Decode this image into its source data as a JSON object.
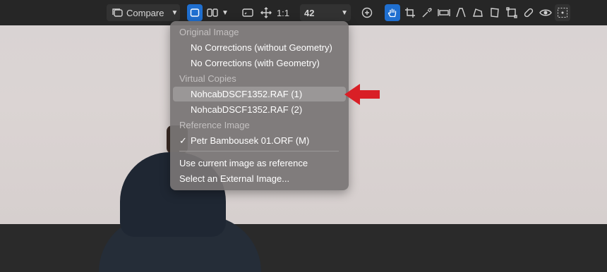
{
  "toolbar": {
    "compare_label": "Compare",
    "zoom_label": "1:1",
    "zoom_value": "42",
    "accent": "#1f6fd0"
  },
  "menu": {
    "sections": {
      "original_header": "Original Image",
      "virtual_header": "Virtual Copies",
      "reference_header": "Reference Image"
    },
    "original_items": [
      "No Corrections (without Geometry)",
      "No Corrections (with Geometry)"
    ],
    "virtual_items": [
      "NohcabDSCF1352.RAF (1)",
      "NohcabDSCF1352.RAF (2)"
    ],
    "reference_item": "Petr Bambousek 01.ORF (M)",
    "check": "✓",
    "actions": [
      "Use current image as reference",
      "Select an External Image..."
    ]
  },
  "annotation": {
    "arrow_color": "#d91f26"
  }
}
